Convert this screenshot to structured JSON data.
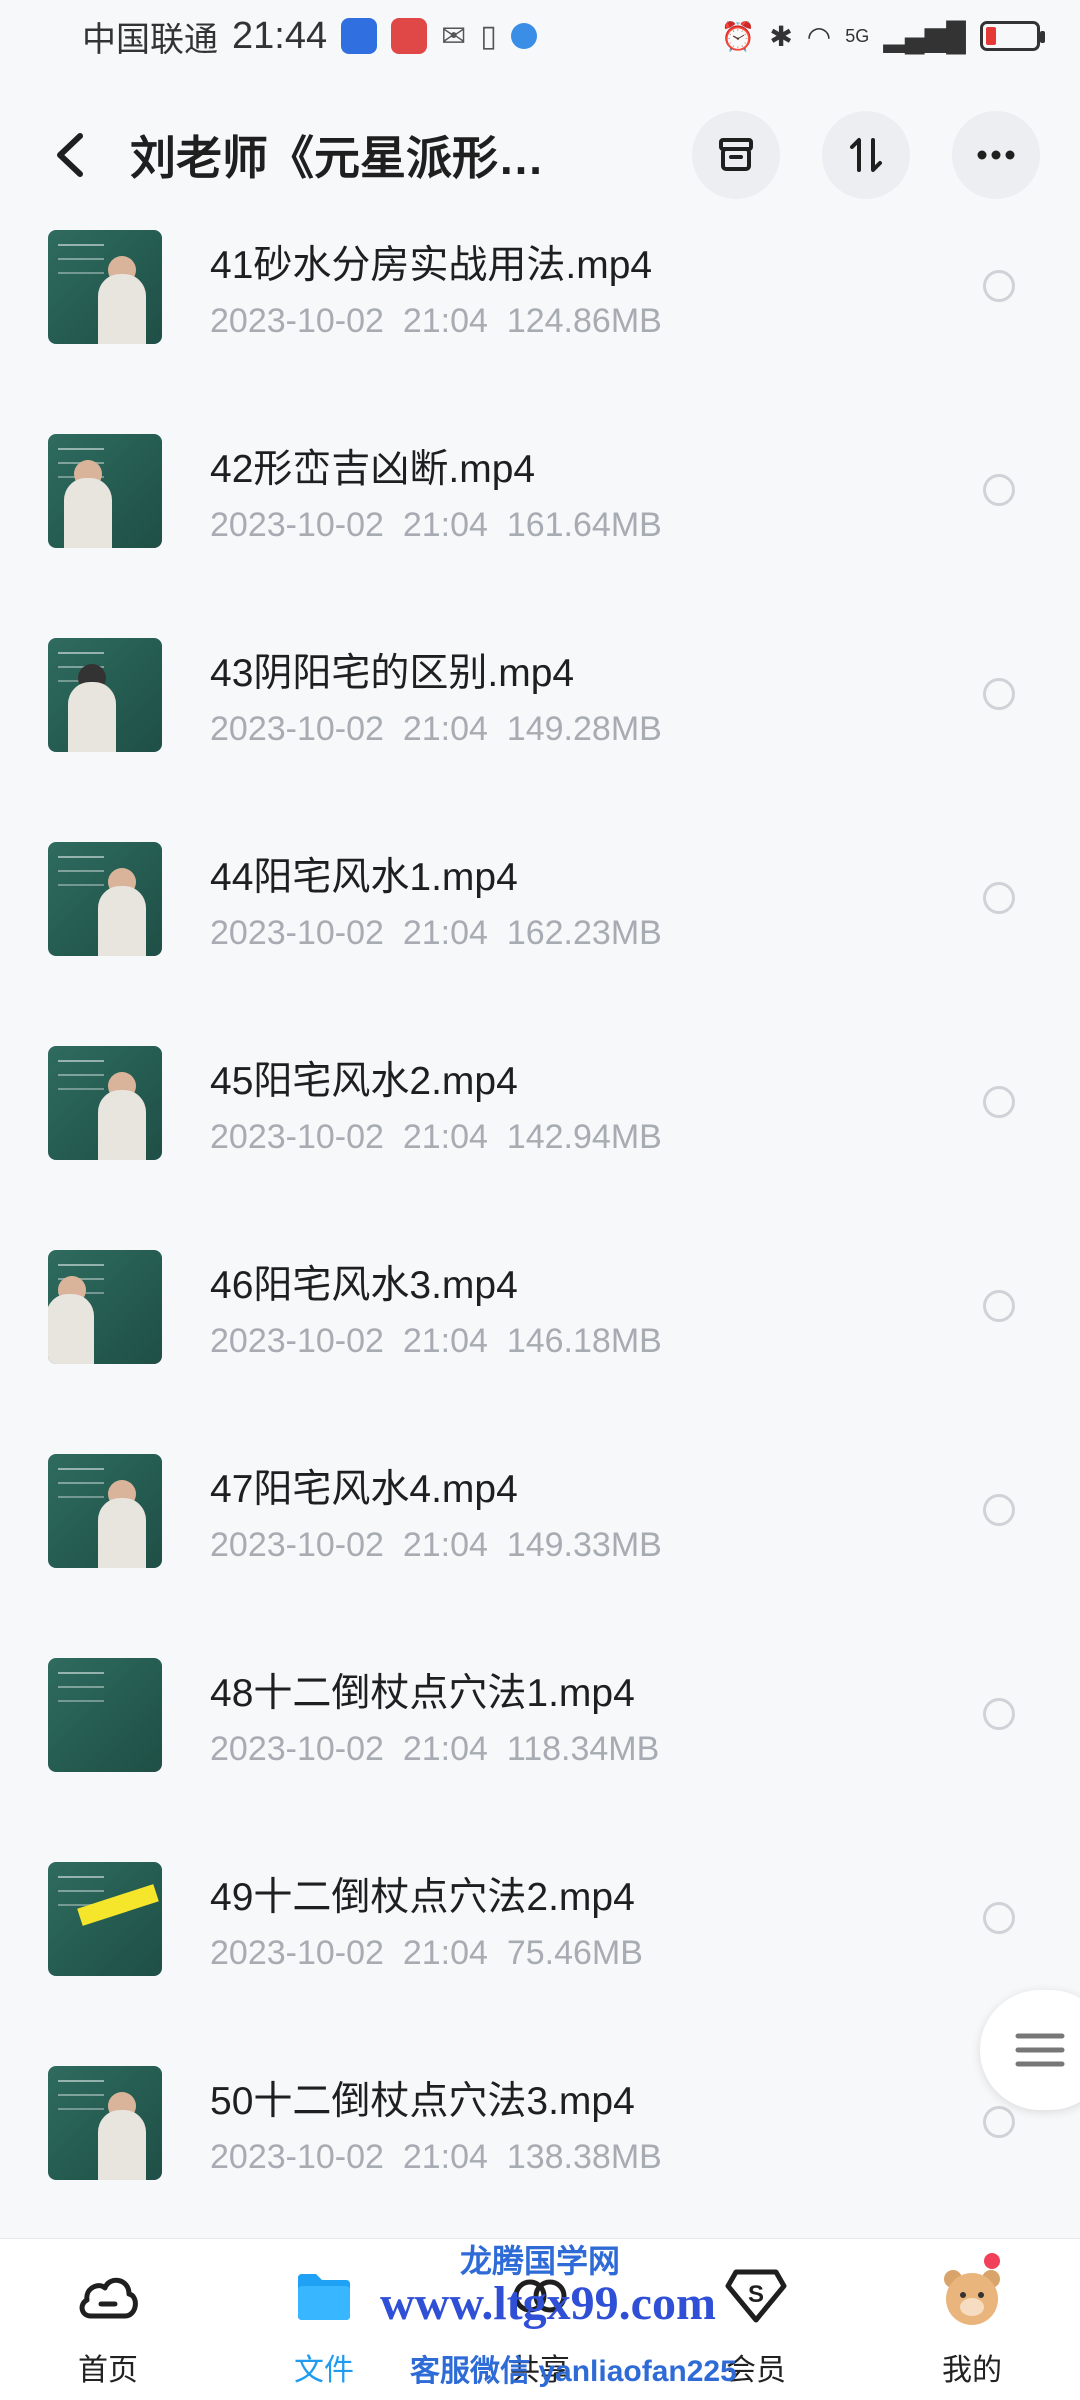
{
  "status_bar": {
    "carrier": "中国联通",
    "time": "21:44",
    "network": "5G"
  },
  "header": {
    "title": "刘老师《元星派形…",
    "icons": [
      "back-icon",
      "archive-icon",
      "sort-icon",
      "more-icon"
    ]
  },
  "files": [
    {
      "name": "41砂水分房实战用法.mp4",
      "date": "2023-10-02",
      "time": "21:04",
      "size": "124.86MB"
    },
    {
      "name": "42形峦吉凶断.mp4",
      "date": "2023-10-02",
      "time": "21:04",
      "size": "161.64MB"
    },
    {
      "name": "43阴阳宅的区别.mp4",
      "date": "2023-10-02",
      "time": "21:04",
      "size": "149.28MB"
    },
    {
      "name": "44阳宅风水1.mp4",
      "date": "2023-10-02",
      "time": "21:04",
      "size": "162.23MB"
    },
    {
      "name": "45阳宅风水2.mp4",
      "date": "2023-10-02",
      "time": "21:04",
      "size": "142.94MB"
    },
    {
      "name": "46阳宅风水3.mp4",
      "date": "2023-10-02",
      "time": "21:04",
      "size": "146.18MB"
    },
    {
      "name": "47阳宅风水4.mp4",
      "date": "2023-10-02",
      "time": "21:04",
      "size": "149.33MB"
    },
    {
      "name": "48十二倒杖点穴法1.mp4",
      "date": "2023-10-02",
      "time": "21:04",
      "size": "118.34MB"
    },
    {
      "name": "49十二倒杖点穴法2.mp4",
      "date": "2023-10-02",
      "time": "21:04",
      "size": "75.46MB"
    },
    {
      "name": "50十二倒杖点穴法3.mp4",
      "date": "2023-10-02",
      "time": "21:04",
      "size": "138.38MB"
    }
  ],
  "nav": {
    "items": [
      {
        "label": "首页",
        "icon": "cloud-icon"
      },
      {
        "label": "文件",
        "icon": "folder-icon"
      },
      {
        "label": "共享",
        "icon": "share-icon"
      },
      {
        "label": "会员",
        "icon": "vip-icon"
      },
      {
        "label": "我的",
        "icon": "avatar-icon"
      }
    ]
  },
  "watermark": {
    "line1": "龙腾国学网",
    "line2": "www.ltgx99.com",
    "line3": "客服微信 yanliaofan225"
  },
  "colors": {
    "accent": "#1f9cf0",
    "background": "#f7f8fa",
    "meta_text": "#a7abb2",
    "badge": "#f2405a"
  }
}
